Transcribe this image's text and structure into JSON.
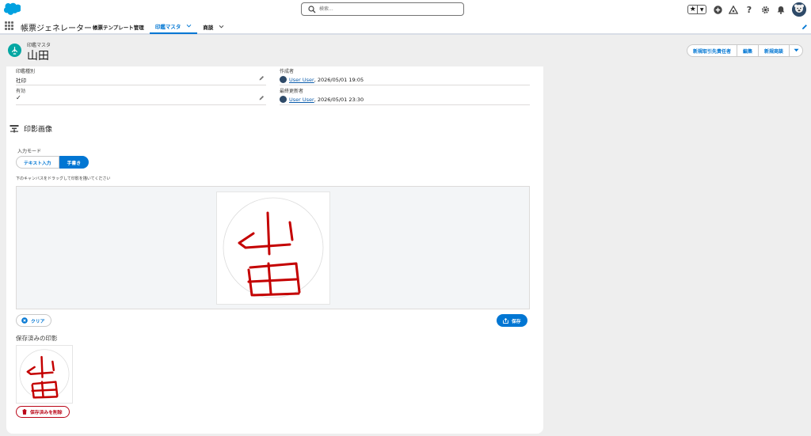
{
  "global_header": {
    "logo": "salesforce-cloud-logo",
    "search_placeholder": "検索...",
    "icons": [
      "favorites-star-icon",
      "add-icon",
      "trailhead-icon",
      "help-icon",
      "setup-gear-icon",
      "notifications-bell-icon",
      "avatar"
    ]
  },
  "app_nav": {
    "app_name": "帳票ジェネレーター",
    "tabs": [
      {
        "label": "帳票テンプレート管理",
        "active": false,
        "has_menu": false
      },
      {
        "label": "印鑑マスタ",
        "active": true,
        "has_menu": true
      },
      {
        "label": "商談",
        "active": false,
        "has_menu": true
      }
    ]
  },
  "record": {
    "object_label": "印鑑マスタ",
    "title": "山田",
    "actions": [
      "新規取引先責任者",
      "編集",
      "新規商談"
    ]
  },
  "fields": {
    "seal_type": {
      "label": "印鑑種別",
      "value": "社印"
    },
    "active": {
      "label": "有効",
      "value": "✓"
    },
    "created_by": {
      "label": "作成者",
      "user": "User User",
      "datetime": ", 2026/05/01 19:05"
    },
    "modified_by": {
      "label": "最終更新者",
      "user": "User User",
      "datetime": ", 2026/05/01 23:30"
    }
  },
  "section": {
    "title": "印影画像",
    "input_mode_label": "入力モード",
    "modes": {
      "text": "テキスト入力",
      "handwriting": "手書き"
    },
    "active_mode": "handwriting",
    "hint": "下のキャンバスをドラッグして印影を描いてください",
    "clear_label": "クリア",
    "save_label": "保存",
    "saved_title": "保存済みの印影",
    "delete_label": "保存済みを削除"
  },
  "colors": {
    "brand": "#0176d3",
    "ink": "#c40000",
    "danger": "#ba0517"
  }
}
